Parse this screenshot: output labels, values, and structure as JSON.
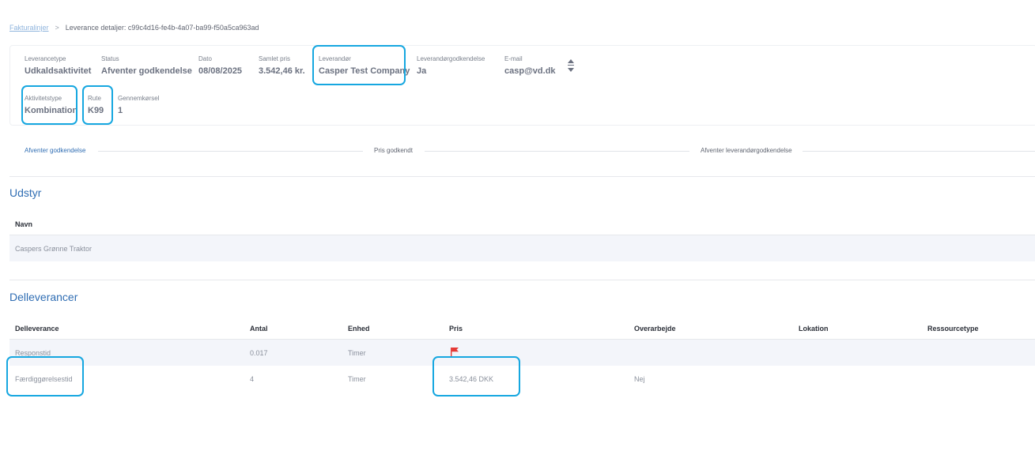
{
  "breadcrumb": {
    "parent": "Fakturalinjer",
    "separator": ">",
    "current": "Leverance detaljer: c99c4d16-fe4b-4a07-ba99-f50a5ca963ad"
  },
  "summary": {
    "leverancetype": {
      "label": "Leverancetype",
      "value": "Udkaldsaktivitet"
    },
    "status": {
      "label": "Status",
      "value": "Afventer godkendelse"
    },
    "dato": {
      "label": "Dato",
      "value": "08/08/2025"
    },
    "samlet_pris": {
      "label": "Samlet pris",
      "value": "3.542,46 kr."
    },
    "leverandor": {
      "label": "Leverandør",
      "value": "Casper Test Company"
    },
    "leverandorgodkendelse": {
      "label": "Leverandørgodkendelse",
      "value": "Ja"
    },
    "email": {
      "label": "E-mail",
      "value": "casp@vd.dk"
    },
    "aktivitetstype": {
      "label": "Aktivitetstype",
      "value": "Kombination"
    },
    "rute": {
      "label": "Rute",
      "value": "K99"
    },
    "gennemkorsel": {
      "label": "Gennemkørsel",
      "value": "1"
    }
  },
  "steps": [
    {
      "label": "Afventer godkendelse",
      "state": "active"
    },
    {
      "label": "Pris godkendt",
      "state": "inactive"
    },
    {
      "label": "Afventer leverandørgodkendelse",
      "state": "inactive"
    }
  ],
  "udstyr": {
    "title": "Udstyr",
    "columns": [
      "Navn"
    ],
    "rows": [
      [
        "Caspers Grønne Traktor"
      ]
    ]
  },
  "delleverancer": {
    "title": "Delleverancer",
    "columns": [
      "Delleverance",
      "Antal",
      "Enhed",
      "Pris",
      "Overarbejde",
      "Lokation",
      "Ressourcetype"
    ],
    "rows": [
      [
        "Responstid",
        "0.017",
        "Timer",
        "",
        "",
        "",
        ""
      ],
      [
        "Færdiggørelsestid",
        "4",
        "Timer",
        "3.542,46 DKK",
        "Nej",
        "",
        ""
      ]
    ]
  },
  "icons": {
    "sort": "sort-icon",
    "flag": "flag-icon"
  },
  "colors": {
    "accent": "#2f6db3",
    "highlight": "#16a7e0",
    "flag": "#e53935",
    "row_shade": "#f3f5fa"
  }
}
